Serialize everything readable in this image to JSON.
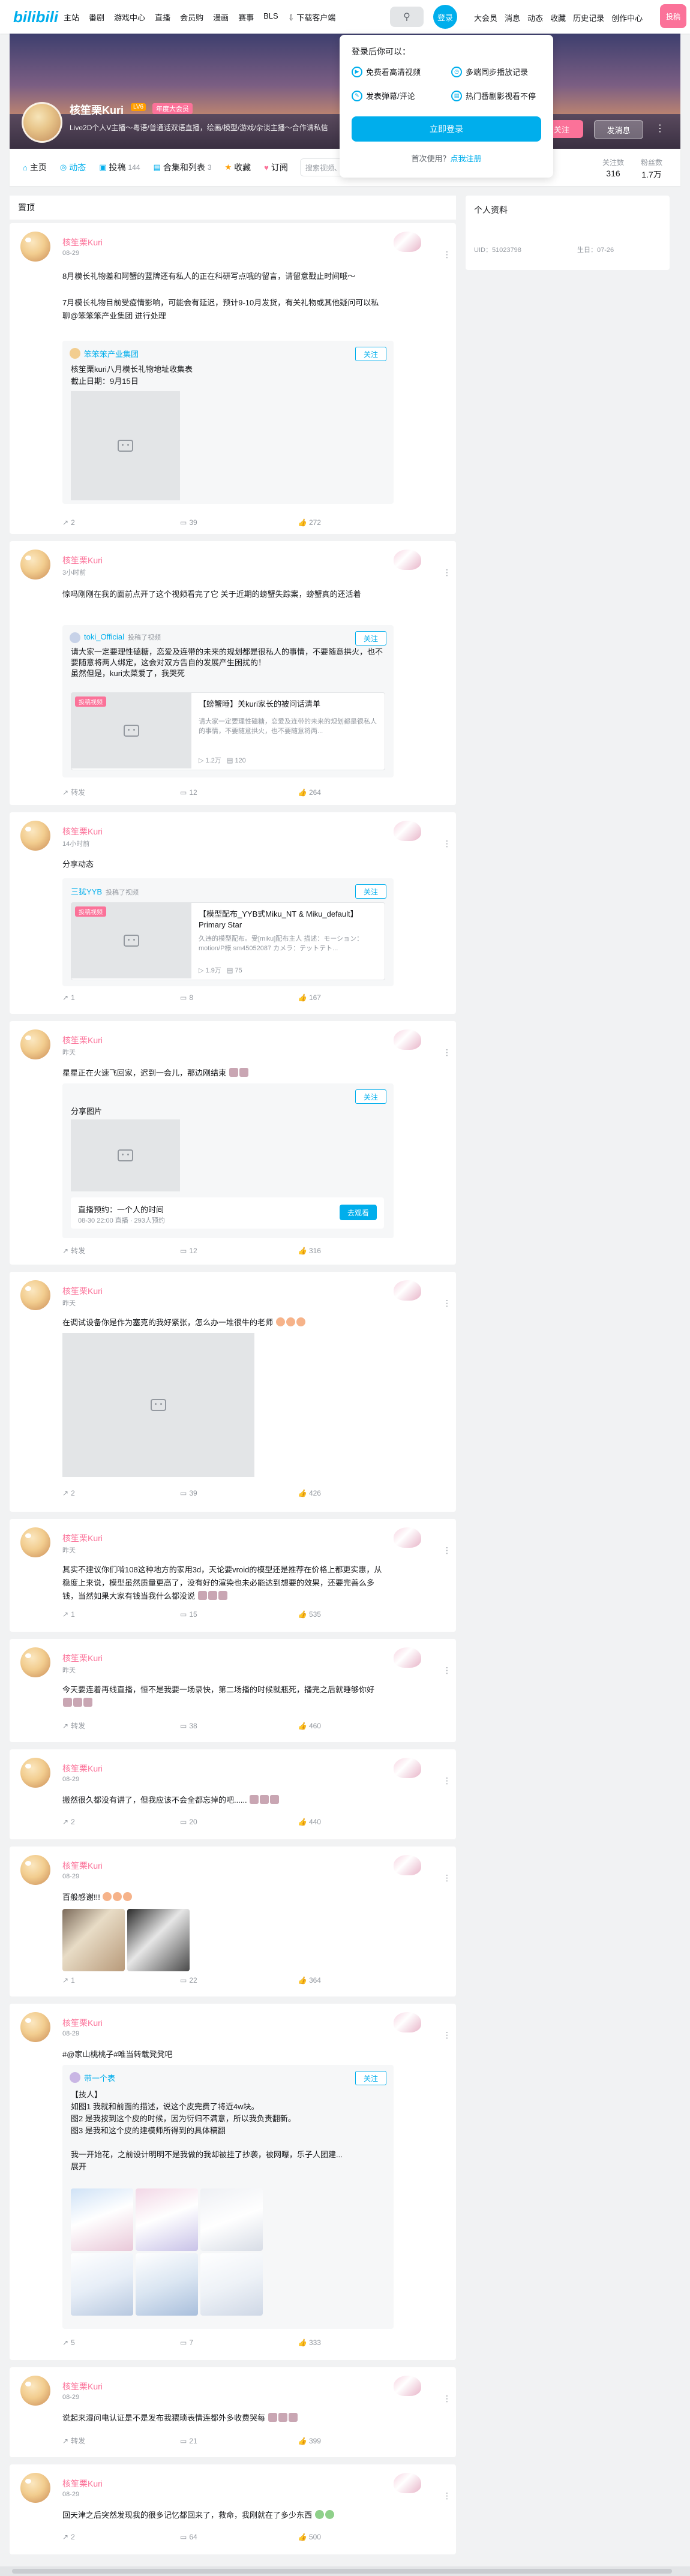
{
  "nav": {
    "logo": "bilibili",
    "left_items": [
      "主站",
      "番剧",
      "游戏中心",
      "直播",
      "会员购",
      "漫画",
      "赛事",
      "BLS",
      "下载客户端"
    ],
    "login": "登录",
    "right_items": [
      "大会员",
      "消息",
      "动态",
      "收藏",
      "历史记录",
      "创作中心"
    ],
    "upload": "投稿"
  },
  "login_popup": {
    "title": "登录后你可以：",
    "items": [
      "免费看高清视频",
      "多端同步播放记录",
      "发表弹幕/评论",
      "热门番剧影视看不停"
    ],
    "button": "立即登录",
    "register_prefix": "首次使用？",
    "register_link": "点我注册"
  },
  "profile": {
    "name": "核笙栗Kuri",
    "level": "LV6",
    "vip": "年度大会员",
    "sign": "Live2D个人V主播～粤语/普通话双语直播，绘画/模型/游戏/杂谈主播～合作请私信",
    "follow_btn": "关注",
    "msg_btn": "发消息",
    "more": "⋮"
  },
  "tabs": [
    {
      "label": "主页",
      "icon": "⌂",
      "count": ""
    },
    {
      "label": "动态",
      "icon": "◎",
      "count": ""
    },
    {
      "label": "投稿",
      "icon": "▣",
      "count": "144"
    },
    {
      "label": "合集和列表",
      "icon": "▤",
      "count": "3"
    },
    {
      "label": "收藏",
      "icon": "★",
      "count": ""
    },
    {
      "label": "订阅",
      "icon": "♥",
      "count": ""
    }
  ],
  "tab_search_placeholder": "搜索视频、动态",
  "stats": [
    {
      "label": "关注数",
      "value": "316"
    },
    {
      "label": "粉丝数",
      "value": "1.7万"
    }
  ],
  "left_header": "置顶",
  "side": {
    "title": "个人资料",
    "uid": "UID：51023798",
    "birthday": "生日：07-26"
  },
  "posts": [
    {
      "name": "核笙栗Kuri",
      "time": "08-29",
      "text": "8月模长礼物差和阿蟹的蓝牌还有私人的正在科研写点哦的留言，请留意戳止时间哦～\n\n7月模长礼物目前受疫情影响，可能会有延迟，预计9-10月发货，有关礼物或其他疑问可以私聊@笨笨笨产业集团 进行处理",
      "mention": "@笨笨笨产业集团",
      "repost_name": "笨笨笨产业集团",
      "repost_follow": "关注",
      "repost_text": "核笙栗kuri八月模长礼物地址收集表\n截止日期：9月15日",
      "forward": "2",
      "comment": "39",
      "like": "272"
    },
    {
      "name": "核笙栗Kuri",
      "time": "3小时前",
      "text": "惊吗刚刚在我的面前点开了这个视频看完了它 关于近期的螃蟹失踪案，螃蟹真的还活着",
      "repost_name": "toki_Official",
      "repost_tag": "投稿了视频",
      "repost_follow": "关注",
      "repost_text": "请大家一定要理性磕糖，恋爱及连带的未来的规划都是很私人的事情，不要随意拱火，也不要随意将两人绑定，这会对双方告自的发展产生困扰的！\n虽然但是，kuri太菜爱了，我哭死",
      "badge": "投稿视频",
      "vtitle": "【螃蟹睡】关kuri家长的被问话清单",
      "vdesc": "请大家一定要理性磕糖，恋爱及连带的未来的规划都是很私人的事情，不要随意拱火，也不要随意将两...",
      "vplay": "1.2万",
      "vdanmu": "120",
      "forward": "转发",
      "comment": "12",
      "like": "264"
    },
    {
      "name": "核笙栗Kuri",
      "time": "14小时前",
      "text": "分享动态",
      "repost_name": "三犹YYB",
      "repost_tag": "投稿了视频",
      "repost_follow": "关注",
      "badge": "投稿视频",
      "vtitle": "【模型配布_YYB式Miku_NT & Miku_default】Primary Star",
      "vdesc": "久违的模型配布。受[miku]配布主人 描述：モーション：motion/P様 sm45052087 カメラ：テットテト...",
      "vplay": "1.9万",
      "vdanmu": "75",
      "forward": "1",
      "comment": "8",
      "like": "167"
    },
    {
      "name": "核笙栗Kuri",
      "time": "昨天",
      "text": "星星正在火速飞回家，迟到一会儿，那边刚结束",
      "repost_text": "分享图片",
      "repost_follow": "关注",
      "reserve_title": "直播预约：一个人的时间",
      "reserve_meta": "08-30 22:00 直播 · 293人预约",
      "reserve_btn": "去观看",
      "forward": "转发",
      "comment": "12",
      "like": "316"
    },
    {
      "name": "核笙栗Kuri",
      "time": "昨天",
      "text": "在调试设备你是作为塞克的我好紧张，怎么办一堆很牛的老师",
      "forward": "2",
      "comment": "39",
      "like": "426"
    },
    {
      "name": "核笙栗Kuri",
      "time": "昨天",
      "text": "其实不建议你们啃108这种地方的家用3d，天论要vroid的模型还是推荐在价格上都更实惠，从稳度上来说，模型虽然质量更高了，没有好的渲染也未必能达到想要的效果，还要完善么多钱，当然如果大家有钱当我什么都没说",
      "forward": "1",
      "comment": "15",
      "like": "535"
    },
    {
      "name": "核笙栗Kuri",
      "time": "昨天",
      "text": "今天要连着再线直播，恒不是我要一场录快，第二场播的时候就瓶死，播完之后就睡够你好",
      "forward": "转发",
      "comment": "38",
      "like": "460"
    },
    {
      "name": "核笙栗Kuri",
      "time": "08-29",
      "text": "搬然很久都没有讲了，但我应该不会全都忘掉的吧......",
      "forward": "2",
      "comment": "20",
      "like": "440"
    },
    {
      "name": "核笙栗Kuri",
      "time": "08-29",
      "text": "百般感谢!!!",
      "forward": "1",
      "comment": "22",
      "like": "364"
    },
    {
      "name": "核笙栗Kuri",
      "time": "08-29",
      "text": "#@家山桃桃子#唯当转载凳凳吧",
      "repost_name": "带一个表",
      "repost_follow": "关注",
      "repost_text": "【技人】\n如图1 我就和前面的描述，说这个皮完费了将近4w块。\n图2 是我按到这个皮的时候，因为衍归不满意，所以我负责翻新。\n图3 是我和这个皮的建模师所得到的具体稿翻\n\n我一开始花，之前设计明明不是我做的我却被挂了抄袭，被网曝，乐子人团建...\n展开",
      "forward": "5",
      "comment": "7",
      "like": "333"
    },
    {
      "name": "核笙栗Kuri",
      "time": "08-29",
      "text": "说起来湿问电认证是不是发布我猥琐表情连都外多收费哭每",
      "forward": "转发",
      "comment": "21",
      "like": "399"
    },
    {
      "name": "核笙栗Kuri",
      "time": "08-29",
      "text": "回天津之后突然发现我的很多记忆都回来了，救命，我刚就在了多少东西",
      "forward": "2",
      "comment": "64",
      "like": "500"
    }
  ],
  "colors": {
    "accent": "#00aeec",
    "pink": "#fb7299",
    "bg": "#f1f2f3",
    "muted": "#9499a0"
  }
}
